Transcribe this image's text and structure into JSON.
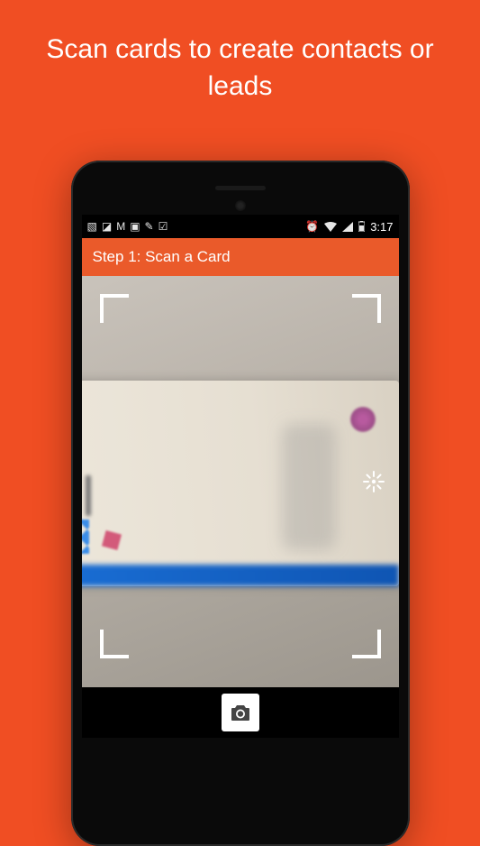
{
  "headline": "Scan cards to create contacts or leads",
  "statusbar": {
    "time": "3:17"
  },
  "appbar": {
    "title": "Step 1: Scan a Card"
  },
  "colors": {
    "brand_bg": "#f04e23",
    "appbar_bg": "#ea5a2a"
  }
}
